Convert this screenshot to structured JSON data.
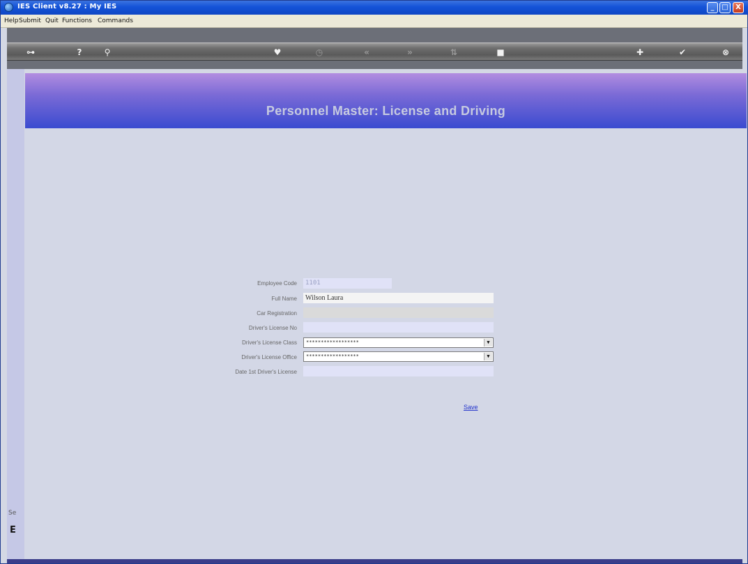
{
  "window": {
    "title": "IES Client v8.27 : My IES",
    "minimize": "_",
    "maximize": "□",
    "close": "X"
  },
  "menu": [
    "Help",
    "Submit",
    "Quit",
    "Functions",
    "Commands"
  ],
  "toolbar": {
    "icons": [
      "key-icon",
      "help-icon",
      "search-icon",
      "heart-icon",
      "clock-icon",
      "back-icon",
      "forward-icon",
      "sort-icon",
      "stop-icon",
      "add-icon",
      "ok-icon",
      "cancel-icon"
    ],
    "glyphs": {
      "key": "⊶",
      "help": "?",
      "search": "⚲",
      "heart": "♥",
      "clock": "◷",
      "back": "«",
      "forward": "»",
      "sort": "⇅",
      "stop": "■",
      "add": "✚",
      "ok": "✔",
      "cancel": "⊗"
    }
  },
  "sidebar": {
    "label": "Se",
    "icon_glyph": "E"
  },
  "page": {
    "title": "Personnel Master: License and Driving"
  },
  "form": {
    "employee_code_label": "Employee Code",
    "employee_code_value": "1101",
    "full_name_label": "Full Name",
    "full_name_value": "Wilson Laura",
    "car_registration_label": "Car Registration",
    "car_registration_value": "",
    "license_no_label": "Driver's License No",
    "license_no_value": "",
    "license_class_label": "Driver's License Class",
    "license_class_value": "******************",
    "license_office_label": "Driver's License Office",
    "license_office_value": "******************",
    "first_license_date_label": "Date 1st Driver's License",
    "first_license_date_value": "",
    "save_label": "Save"
  },
  "colors": {
    "banner_top": "#b28de0",
    "banner_bottom": "#3a4bd0",
    "title_text": "#c7cbe0",
    "link": "#2233cc"
  }
}
